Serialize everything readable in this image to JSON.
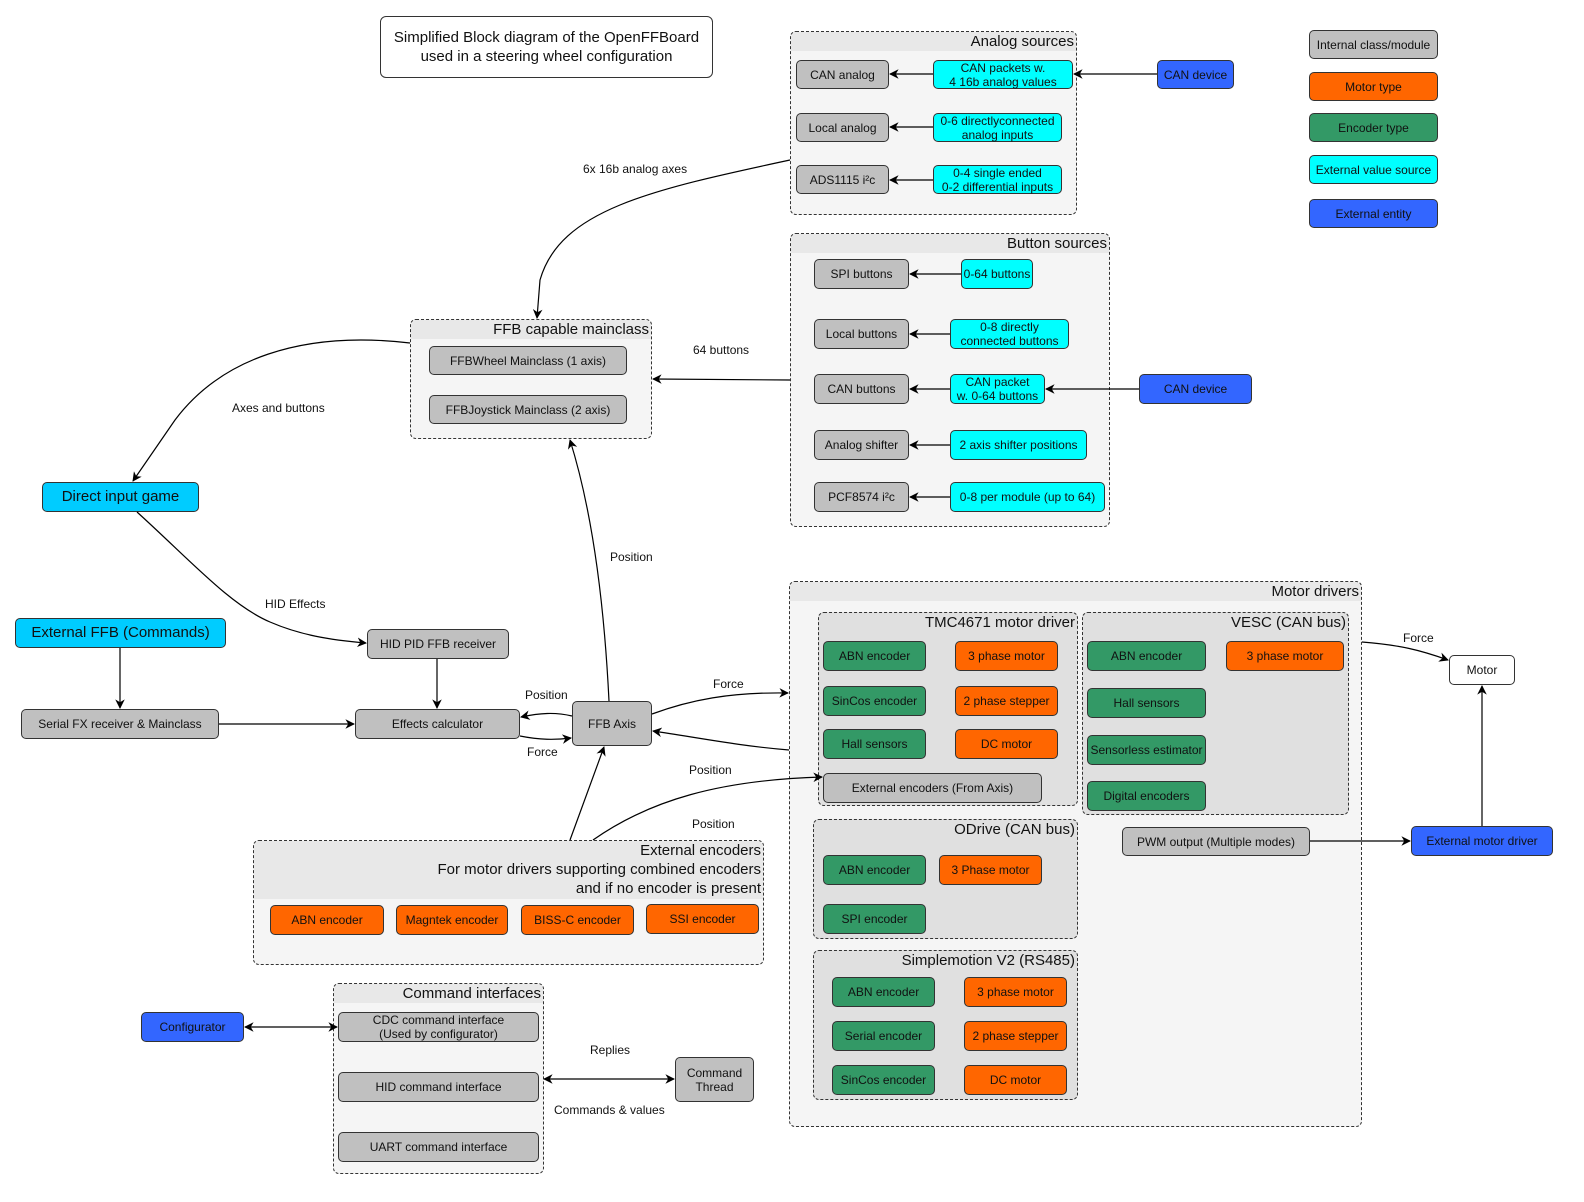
{
  "title": "Simplified Block diagram of the OpenFFBoard\nused in a steering wheel configuration",
  "legend": [
    {
      "label": "Internal class/module",
      "color": "#c0c0c0"
    },
    {
      "label": "Motor type",
      "color": "#ff6600"
    },
    {
      "label": "Encoder type",
      "color": "#339966"
    },
    {
      "label": "External value source",
      "color": "#00ffff"
    },
    {
      "label": "External entity",
      "color": "#3366ff"
    }
  ],
  "analog_sources": {
    "header": "Analog sources",
    "modules": [
      "CAN analog",
      "Local analog",
      "ADS1115 i²c"
    ],
    "sources": [
      "CAN packets w.\n4 16b analog values",
      "0-6 directlyconnected\nanalog inputs",
      "0-4 single ended\n0-2 differential inputs"
    ],
    "can_device": "CAN device"
  },
  "button_sources": {
    "header": "Button sources",
    "modules": [
      "SPI buttons",
      "Local buttons",
      "CAN buttons",
      "Analog shifter",
      "PCF8574 i²c"
    ],
    "sources": [
      "0-64 buttons",
      "0-8 directly\nconnected buttons",
      "CAN packet\nw. 0-64 buttons",
      "2 axis shifter positions",
      "0-8 per module (up to 64)"
    ],
    "can_device": "CAN device"
  },
  "mainclass": {
    "header": "FFB capable mainclass",
    "items": [
      "FFBWheel Mainclass (1 axis)",
      "FFBJoystick Mainclass (2 axis)"
    ]
  },
  "nodes": {
    "direct_input_game": "Direct input game",
    "external_ffb": "External FFB (Commands)",
    "hid_pid": "HID PID FFB receiver",
    "serial_fx": "Serial FX receiver & Mainclass",
    "effects_calc": "Effects calculator",
    "ffb_axis": "FFB Axis",
    "motor": "Motor",
    "external_motor_driver": "External motor driver",
    "pwm_output": "PWM output (Multiple modes)",
    "configurator": "Configurator",
    "command_thread": "Command\nThread"
  },
  "edge_labels": {
    "analog_axes": "6x 16b analog axes",
    "buttons": "64 buttons",
    "axes_buttons": "Axes and buttons",
    "hid_effects": "HID Effects",
    "position_main": "Position",
    "position_calc": "Position",
    "force_calc": "Force",
    "force_driver": "Force",
    "position_driver": "Position",
    "position_ext": "Position",
    "force_motor": "Force",
    "replies": "Replies",
    "commands_values": "Commands & values"
  },
  "motor_drivers": {
    "header": "Motor drivers",
    "tmc": {
      "header": "TMC4671 motor driver",
      "encoders": [
        "ABN encoder",
        "SinCos encoder",
        "Hall sensors"
      ],
      "motors": [
        "3 phase motor",
        "2 phase stepper",
        "DC motor"
      ],
      "external": "External encoders (From Axis)"
    },
    "vesc": {
      "header": "VESC (CAN bus)",
      "encoders": [
        "ABN encoder",
        "Hall sensors",
        "Sensorless estimator",
        "Digital encoders"
      ],
      "motors": [
        "3 phase motor"
      ]
    },
    "odrive": {
      "header": "ODrive (CAN bus)",
      "encoders": [
        "ABN encoder",
        "SPI encoder"
      ],
      "motors": [
        "3 Phase motor"
      ]
    },
    "simplemotion": {
      "header": "Simplemotion V2 (RS485)",
      "encoders": [
        "ABN encoder",
        "Serial encoder",
        "SinCos encoder"
      ],
      "motors": [
        "3 phase motor",
        "2 phase stepper",
        "DC motor"
      ]
    }
  },
  "external_encoders": {
    "header": "External encoders\nFor motor drivers supporting combined encoders\nand if no encoder is present",
    "items": [
      "ABN encoder",
      "Magntek encoder",
      "BISS-C encoder",
      "SSI encoder"
    ]
  },
  "command_interfaces": {
    "header": "Command interfaces",
    "items": [
      "CDC command interface\n(Used by configurator)",
      "HID command interface",
      "UART command interface"
    ]
  }
}
